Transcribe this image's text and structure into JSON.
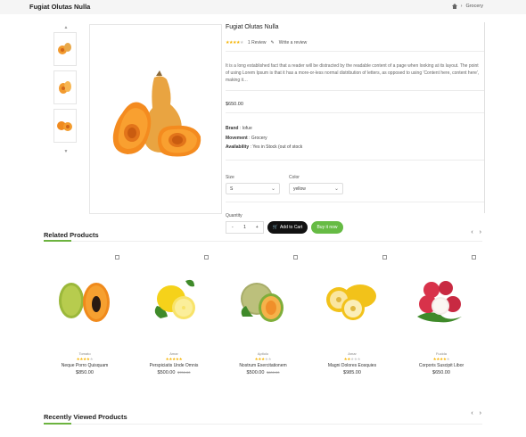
{
  "header": {
    "title": "Fugiat Olutas Nulla",
    "breadcrumb": {
      "current": "Grocery"
    }
  },
  "product": {
    "title": "Fugiat Olutas Nulla",
    "rating": 4,
    "review_count": "1 Review",
    "write_review": "Write a review",
    "description": "It is a long established fact that a reader will be distracted by the readable content of a page when looking at its layout. The point of using Lorem Ipsum is that it has a more-or-less normal distribution of letters, as opposed to using 'Content here, content here', making it…",
    "price": "$650.00",
    "brand_label": "Brand",
    "brand_value": "Iofue",
    "movement_label": "Movement",
    "movement_value": "Grocery",
    "availability_label": "Availability",
    "availability_value": "Yes in Stock (out of stock",
    "size_label": "Size",
    "size_value": "S",
    "color_label": "Color",
    "color_value": "yellow",
    "quantity_label": "Quantity",
    "quantity": "1",
    "minus": "-",
    "plus": "+",
    "add_to_cart": "Add to Cart",
    "buy_now": "Buy it now"
  },
  "related": {
    "title": "Related Products",
    "items": [
      {
        "category": "Tomato",
        "rating": 4,
        "name": "Neque Porro Quisquam",
        "price": "$850.00",
        "old_price": ""
      },
      {
        "category": "Amar",
        "rating": 5,
        "name": "Perspiciatis Unde Omnis",
        "price": "$500.00",
        "old_price": "$700.00"
      },
      {
        "category": "Aptiolo",
        "rating": 3,
        "name": "Nostrum Exercitationem",
        "price": "$500.00",
        "old_price": "$600.00"
      },
      {
        "category": "Amar",
        "rating": 2,
        "name": "Magni Dolores Eosquies",
        "price": "$985.00",
        "old_price": ""
      },
      {
        "category": "Fucida",
        "rating": 4,
        "name": "Corporis Suscipit Libor",
        "price": "$650.00",
        "old_price": ""
      }
    ]
  },
  "recent": {
    "title": "Recently Viewed Products"
  },
  "icons": {
    "home": "home-icon",
    "cart": "cart-icon",
    "pencil": "pencil-icon",
    "prev": "chevron-left-icon",
    "next": "chevron-right-icon"
  },
  "colors": {
    "accent": "#6cb33f",
    "cart_button": "#111111",
    "buy_button": "#66bb44",
    "star": "#f5b301"
  }
}
